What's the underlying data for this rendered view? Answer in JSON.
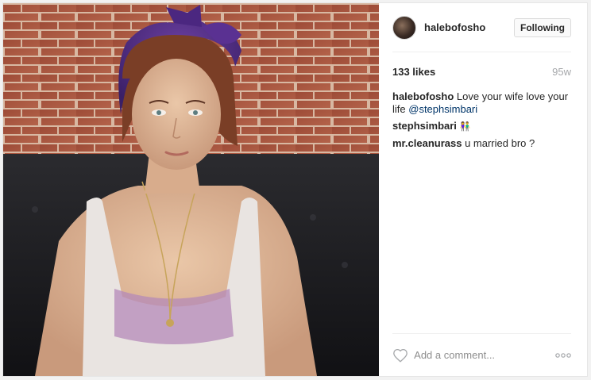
{
  "post": {
    "author": "halebofosho",
    "follow_label": "Following",
    "likes": "133 likes",
    "age": "95w",
    "caption": {
      "author": "halebofosho",
      "text": "Love your wife love your life",
      "mention": "@stephsimbari"
    },
    "comments": [
      {
        "author": "stephsimbari",
        "text": "👫"
      },
      {
        "author": "mr.cleanurass",
        "text": "u married bro ?"
      }
    ],
    "add_comment_placeholder": "Add a comment...",
    "more_label": "ooo"
  },
  "icons": {
    "like": "heart-outline-icon",
    "more": "more-options-icon"
  },
  "colors": {
    "border": "#e6e6e6",
    "mention": "#003569",
    "muted": "#a5a7aa",
    "text": "#262626"
  }
}
